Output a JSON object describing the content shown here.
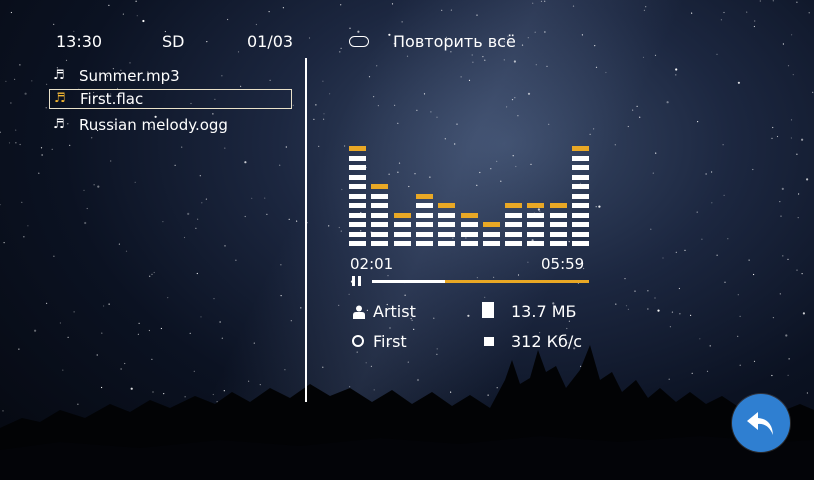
{
  "status_bar": {
    "clock": "13:30",
    "source": "SD",
    "track_counter": "01/03",
    "repeat_label": "Повторить всё"
  },
  "playlist": {
    "tracks": [
      {
        "title": "Summer.mp3",
        "selected": false
      },
      {
        "title": "First.flac",
        "selected": true
      },
      {
        "title": "Russian melody.ogg",
        "selected": false
      }
    ]
  },
  "player": {
    "elapsed": "02:01",
    "total": "05:59",
    "progress": 0.337,
    "state": "playing",
    "equalizer_levels": [
      10,
      6,
      3,
      5,
      4,
      3,
      2,
      4,
      4,
      4,
      10
    ]
  },
  "track_info": {
    "artist": "Artist",
    "album": "First",
    "file_size": "13.7 МБ",
    "bitrate": "312 Кб/с"
  },
  "icons": {
    "track": "music-note-icon",
    "repeat": "repeat-toggle-icon",
    "pause": "pause-icon",
    "artist": "person-icon",
    "album": "disc-icon",
    "size": "file-icon",
    "bitrate": "bitrate-icon",
    "back": "back-arrow-icon"
  },
  "colors": {
    "accent": "#e9a825",
    "selection_border": "#e9e1c9",
    "back_button": "#2f7fd1",
    "text": "#ffffff"
  }
}
